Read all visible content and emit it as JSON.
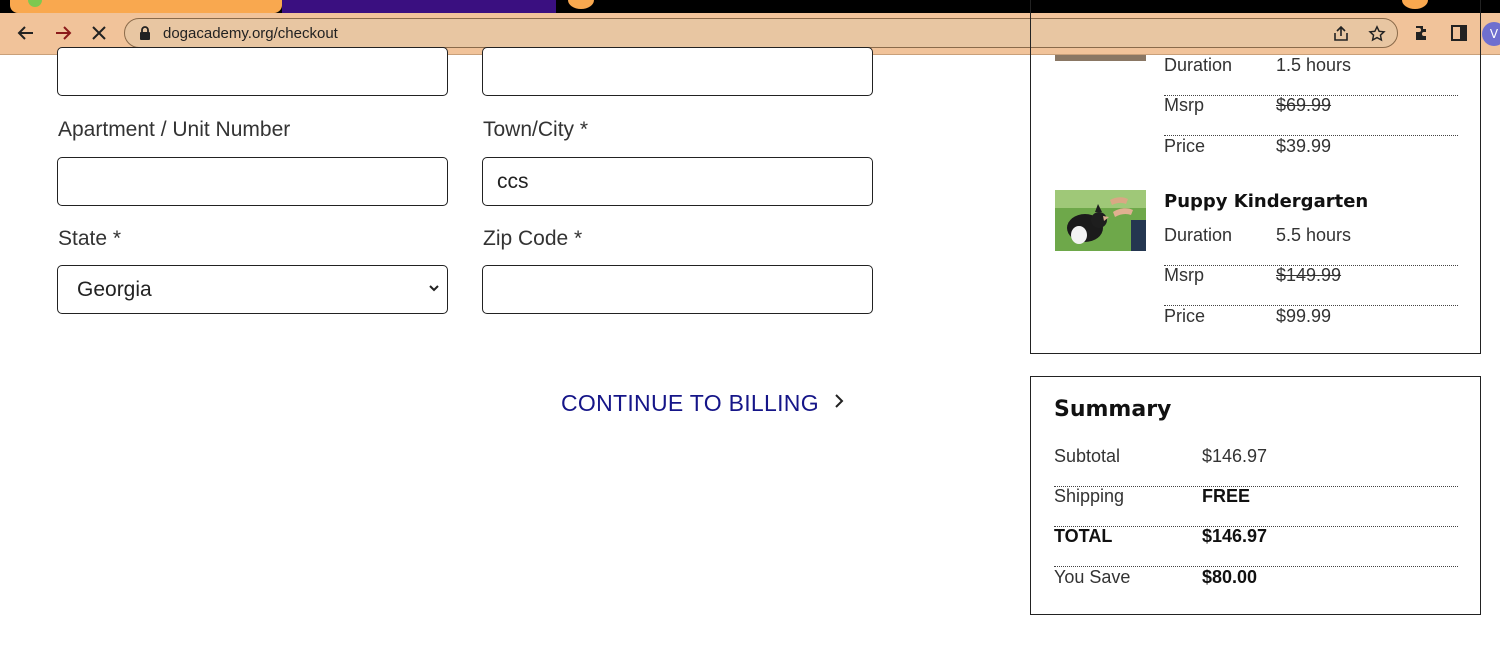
{
  "browser": {
    "url": "dogacademy.org/checkout",
    "avatar_letter": "V"
  },
  "form": {
    "apartment_label": "Apartment / Unit Number",
    "apartment_value": "",
    "town_label": "Town/City *",
    "town_value": "ccs",
    "state_label": "State *",
    "state_value": "Georgia",
    "zip_label": "Zip Code *",
    "zip_value": "",
    "top_left_value": "",
    "top_right_value": "",
    "continue_label": "CONTINUE TO BILLING"
  },
  "order": {
    "items": [
      {
        "title": "",
        "duration_label": "Duration",
        "duration": "1.5 hours",
        "msrp_label": "Msrp",
        "msrp": "$69.99",
        "price_label": "Price",
        "price": "$39.99"
      },
      {
        "title": "Puppy Kindergarten",
        "duration_label": "Duration",
        "duration": "5.5 hours",
        "msrp_label": "Msrp",
        "msrp": "$149.99",
        "price_label": "Price",
        "price": "$99.99"
      }
    ]
  },
  "summary": {
    "title": "Summary",
    "subtotal_label": "Subtotal",
    "subtotal": "$146.97",
    "shipping_label": "Shipping",
    "shipping": "FREE",
    "total_label": "TOTAL",
    "total": "$146.97",
    "save_label": "You Save",
    "save": "$80.00"
  },
  "colors": {
    "toolbar": "#f1c39a",
    "accent_link": "#151588",
    "tab_orange": "#f9a84f",
    "tab_purple": "#3a0f80"
  }
}
